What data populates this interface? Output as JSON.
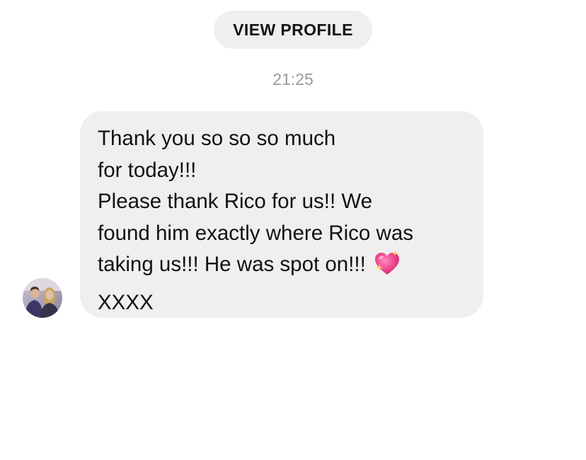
{
  "header": {
    "view_profile_label": "VIEW PROFILE"
  },
  "thread": {
    "timestamp": "21:25"
  },
  "message": {
    "sender_avatar_icon": "profile-photo-couple",
    "lines": [
      "Thank you so so so much",
      "for today!!!",
      "Please thank Rico for us!! We",
      "found him exactly where Rico was",
      "taking us!!! He was spot on!!!",
      "XXXX"
    ],
    "emoji_icon": "sparkling-heart-icon",
    "bubble_color": "#efefef"
  },
  "colors": {
    "background": "#ffffff",
    "pill_background": "#efefef",
    "timestamp_text": "#9a9a9a",
    "message_text": "#111111",
    "emoji_heart": "#e8357a"
  }
}
